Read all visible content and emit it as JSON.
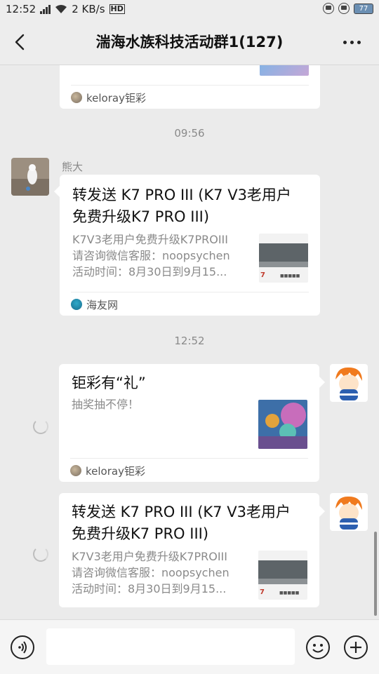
{
  "status_bar": {
    "time": "12:52",
    "network_speed": "2 KB/s",
    "hd_badge": "HD",
    "battery": "77",
    "icons": [
      "signal-icon",
      "wifi-icon",
      "alarm-icon",
      "lock-rotation-icon",
      "battery-icon"
    ]
  },
  "navbar": {
    "title": "湍海水族科技活动群1(127)",
    "icons": [
      "back-icon",
      "more-icon"
    ]
  },
  "messages": [
    {
      "type": "link-card-partial",
      "source": "keloray钜彩"
    },
    {
      "type": "time",
      "text": "09:56"
    },
    {
      "type": "link-card",
      "sender": "熊大",
      "title_lines": [
        "转发送 K7 PRO III (K7 V3老用户",
        "免费升级K7 PRO III)"
      ],
      "desc_lines": [
        "K7V3老用户免费升级K7PROIII",
        "请咨询微信客服：noopsychen",
        "活动时间：8月30日到9月15..."
      ],
      "source": "海友网"
    },
    {
      "type": "time",
      "text": "12:52"
    },
    {
      "type": "link-card-self",
      "title_lines": [
        "钜彩有“礼”"
      ],
      "desc_lines": [
        "抽奖抽不停！"
      ],
      "source": "keloray钜彩",
      "status": "sending"
    },
    {
      "type": "link-card-self",
      "title_lines": [
        "转发送 K7 PRO III (K7 V3老用户",
        "免费升级K7 PRO III)"
      ],
      "desc_lines": [
        "K7V3老用户免费升级K7PROIII",
        "请咨询微信客服：noopsychen",
        "活动时间：8月30日到9月15..."
      ],
      "status": "sending"
    }
  ],
  "input_bar": {
    "value": "",
    "icons": [
      "voice-icon",
      "emoji-icon",
      "plus-icon"
    ]
  },
  "colors": {
    "chat_bg": "#ebebeb",
    "bubble": "#ffffff",
    "muted_text": "#8a8a8a"
  }
}
